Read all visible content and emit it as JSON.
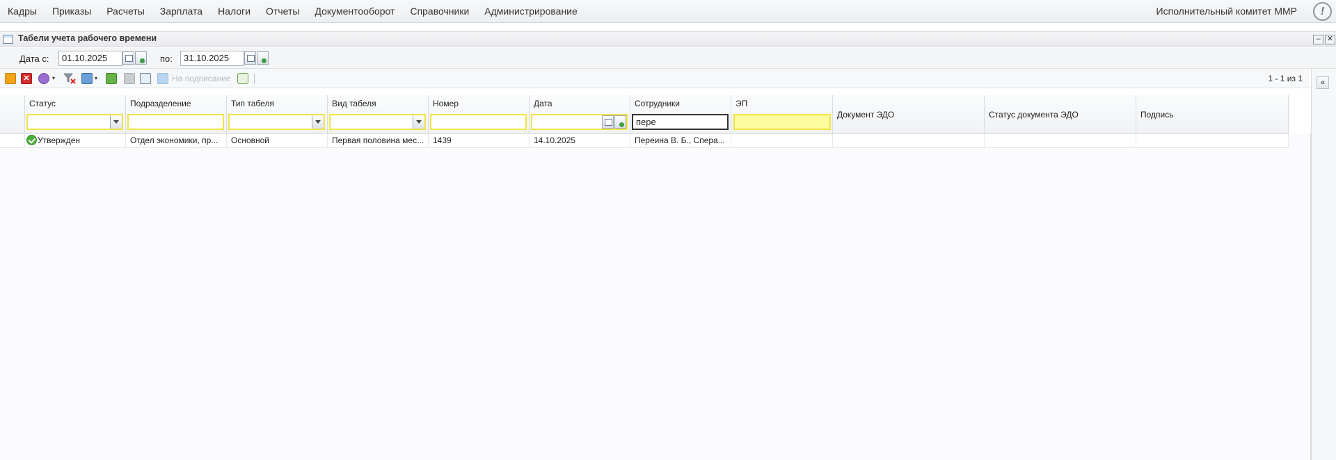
{
  "menu": {
    "items": [
      "Кадры",
      "Приказы",
      "Расчеты",
      "Зарплата",
      "Налоги",
      "Отчеты",
      "Документооборот",
      "Справочники",
      "Администрирование"
    ],
    "organization": "Исполнительный комитет ММР",
    "help_symbol": "!"
  },
  "window": {
    "title": "Табели учета рабочего времени",
    "minimize_symbol": "–",
    "close_symbol": "✕"
  },
  "dates": {
    "from_label": "Дата с:",
    "from_value": "01.10.2025",
    "to_label": "по:",
    "to_value": "31.10.2025"
  },
  "toolbar": {
    "delete_symbol": "✕",
    "dropdown_symbol": "▾",
    "send_label": "На подписание",
    "pager": "1 - 1 из 1",
    "collapse_symbol": "«"
  },
  "grid": {
    "columns": [
      "Статус",
      "Подразделение",
      "Тип табеля",
      "Вид табеля",
      "Номер",
      "Дата",
      "Сотрудники",
      "ЭП",
      "Документ ЭДО",
      "Статус документа ЭДО",
      "Подпись"
    ],
    "filters": {
      "employees": "пере"
    },
    "rows": [
      {
        "status": "Утвержден",
        "department": "Отдел экономики, пр...",
        "type": "Основной",
        "kind": "Первая половина мес...",
        "number": "1439",
        "date": "14.10.2025",
        "employees": "Переина В. Б., Спера..."
      }
    ]
  }
}
